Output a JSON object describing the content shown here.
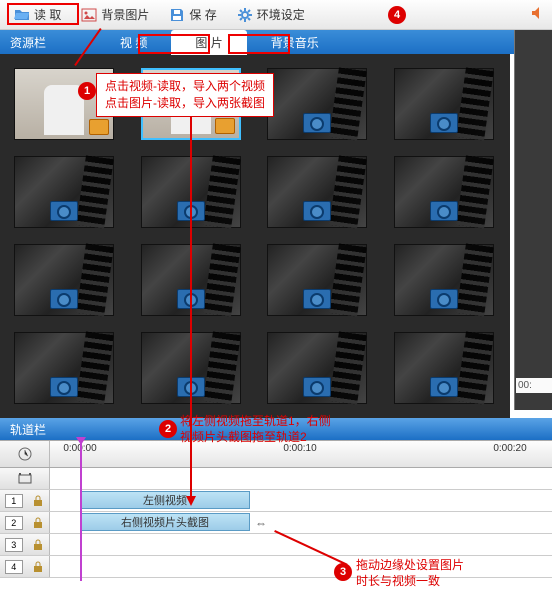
{
  "toolbar": {
    "read": "读 取",
    "bgimage": "背景图片",
    "save": "保 存",
    "settings": "环境设定"
  },
  "panel": {
    "resources": "资源栏"
  },
  "tabs": {
    "video": "视 频",
    "image": "图 片",
    "bgm": "背景音乐"
  },
  "trackPanel": {
    "title": "轨道栏"
  },
  "ruler": {
    "t0": "0:00:00",
    "t1": "0:00:10",
    "t2": "0:00:20"
  },
  "tracks": {
    "nums": [
      "1",
      "2",
      "3",
      "4"
    ],
    "clip1": "左侧视频",
    "clip2": "右侧视频片头截图"
  },
  "annot": {
    "c1a": "点击视频-读取，导入两个视频",
    "c1b": "点击图片-读取，导入两张截图",
    "c2a": "将左侧视频拖至轨道1，右侧",
    "c2b": "视频片头截图拖至轨道2",
    "c3a": "拖动边缘处设置图片",
    "c3b": "时长与视频一致"
  },
  "preview": {
    "time": "00:"
  }
}
